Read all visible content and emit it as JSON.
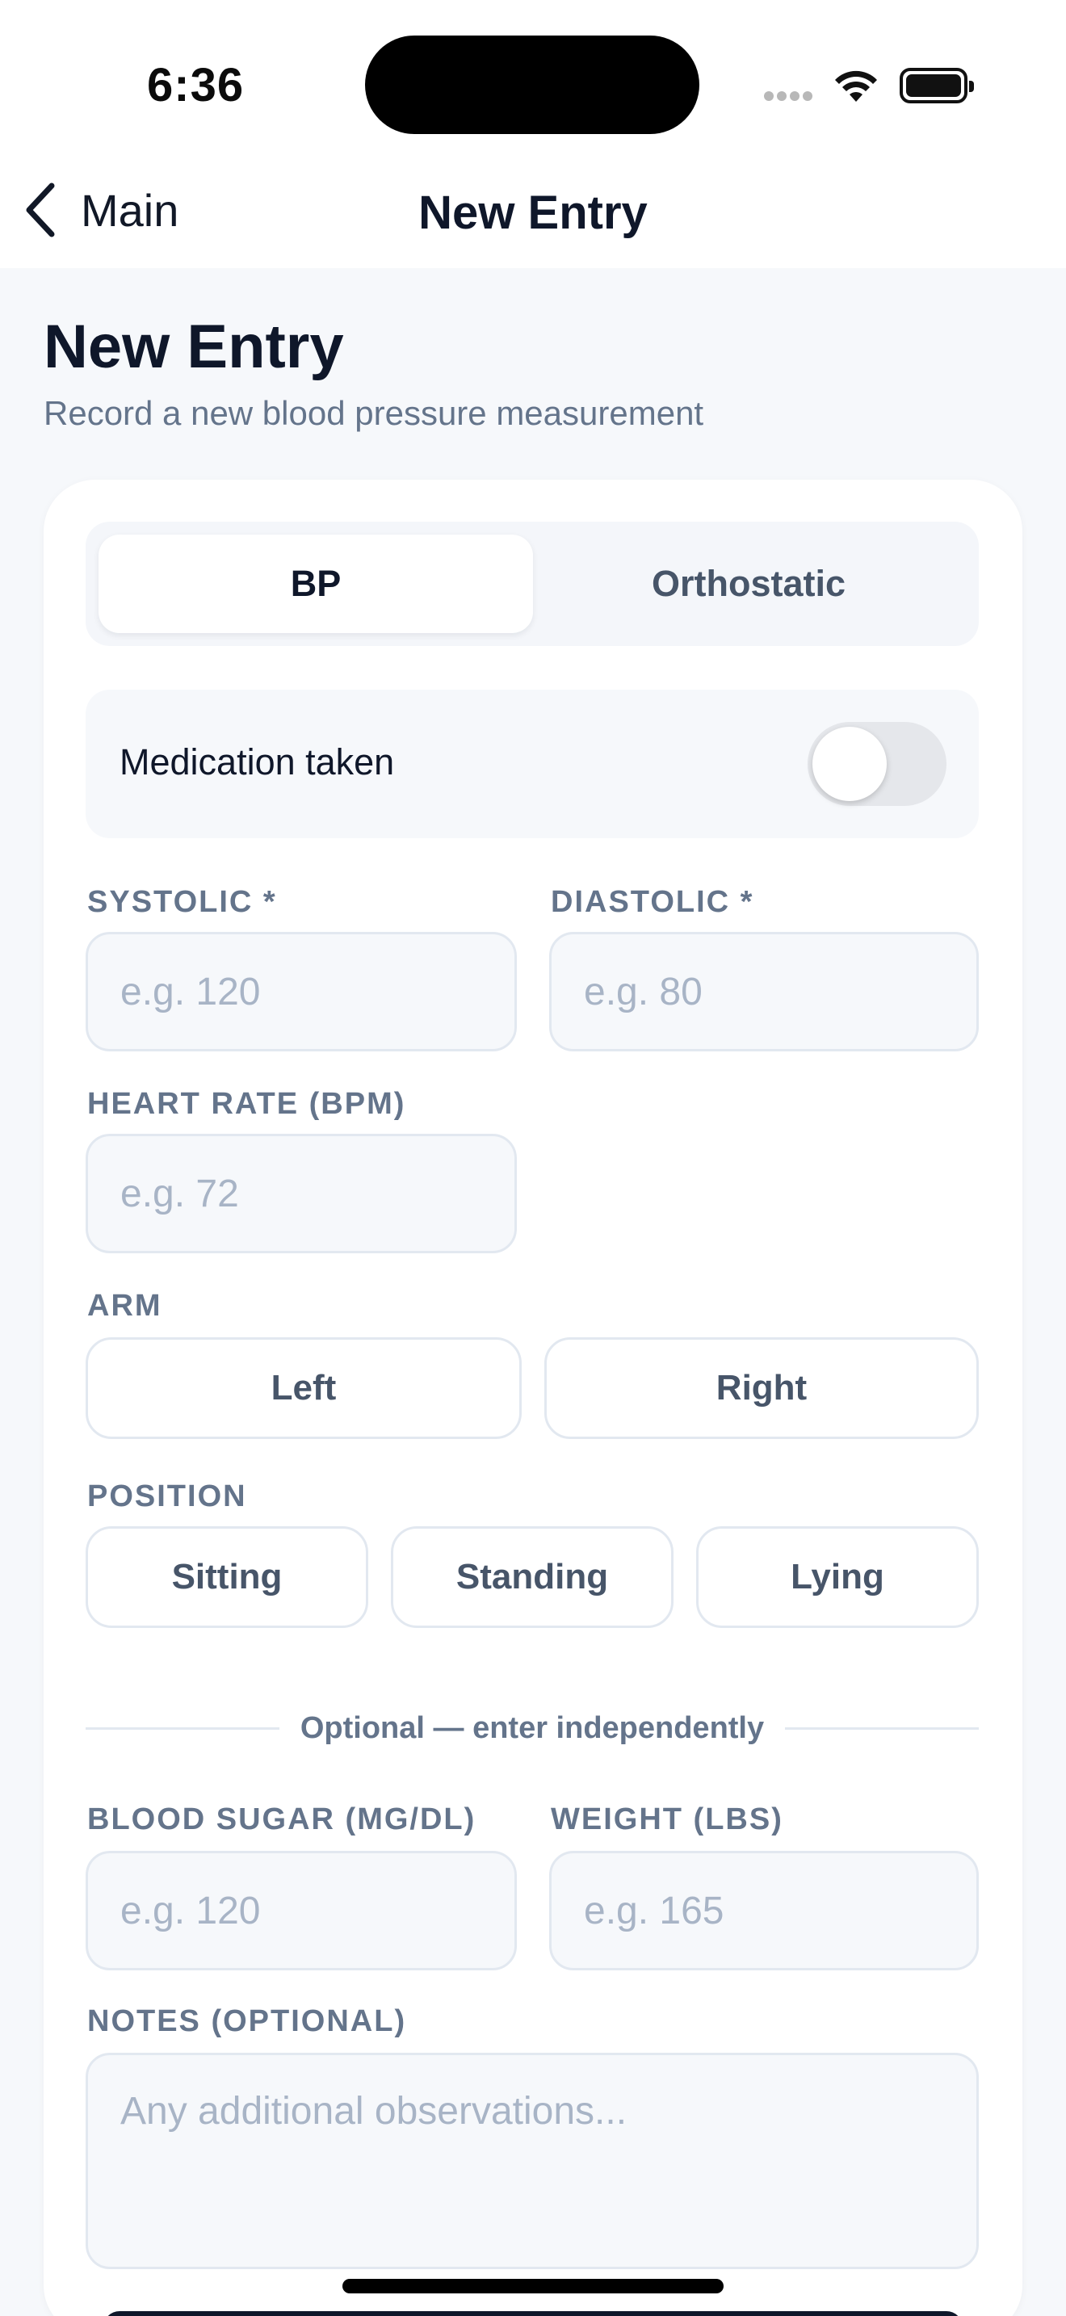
{
  "status_bar": {
    "time": "6:36"
  },
  "nav": {
    "back_label": "Main",
    "title": "New Entry"
  },
  "header": {
    "title": "New Entry",
    "subtitle": "Record a new blood pressure measurement"
  },
  "tabs": [
    {
      "label": "BP",
      "active": true
    },
    {
      "label": "Orthostatic",
      "active": false
    }
  ],
  "medication": {
    "label": "Medication taken",
    "on": false
  },
  "fields": {
    "systolic": {
      "label": "SYSTOLIC *",
      "placeholder": "e.g. 120",
      "value": ""
    },
    "diastolic": {
      "label": "DIASTOLIC *",
      "placeholder": "e.g. 80",
      "value": ""
    },
    "heart_rate": {
      "label": "HEART RATE (BPM)",
      "placeholder": "e.g. 72",
      "value": ""
    },
    "blood_sugar": {
      "label": "BLOOD SUGAR (MG/DL)",
      "placeholder": "e.g. 120",
      "value": ""
    },
    "weight": {
      "label": "WEIGHT (LBS)",
      "placeholder": "e.g. 165",
      "value": ""
    },
    "notes": {
      "label": "NOTES (OPTIONAL)",
      "placeholder": "Any additional observations...",
      "value": ""
    }
  },
  "arm": {
    "label": "ARM",
    "options": [
      "Left",
      "Right"
    ]
  },
  "position": {
    "label": "POSITION",
    "options": [
      "Sitting",
      "Standing",
      "Lying"
    ]
  },
  "optional_divider": "Optional — enter independently",
  "colors": {
    "accent": "#0f172a",
    "muted_text": "#64748b",
    "placeholder": "#a8b4c6",
    "border": "#e2e8f0",
    "background": "#f6f8fb"
  }
}
